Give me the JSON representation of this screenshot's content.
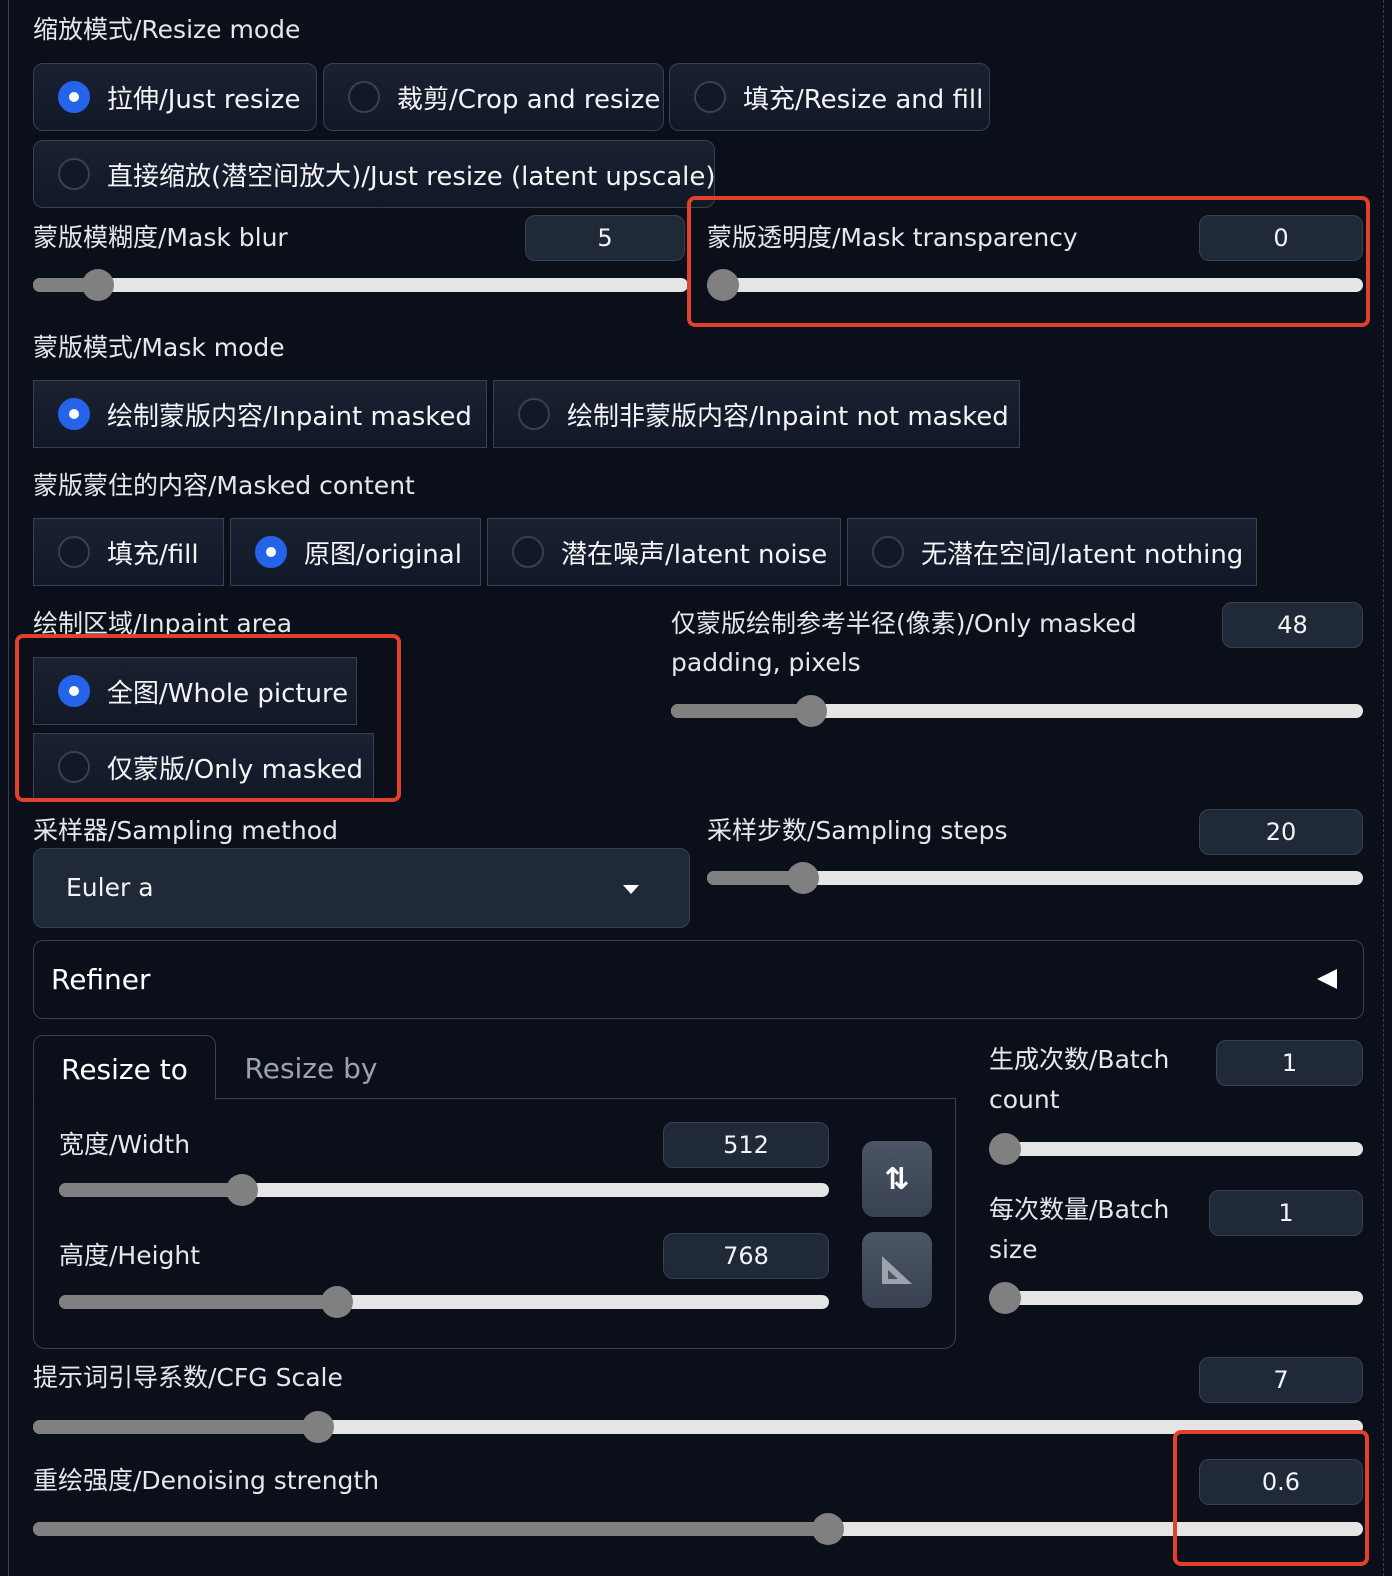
{
  "resize_mode": {
    "label": "缩放模式/Resize mode",
    "options": [
      "拉伸/Just resize",
      "裁剪/Crop and resize",
      "填充/Resize and fill",
      "直接缩放(潜空间放大)/Just resize (latent upscale)"
    ],
    "selected": 0
  },
  "mask_blur": {
    "label": "蒙版模糊度/Mask blur",
    "value": "5",
    "min": 0,
    "max": 64
  },
  "mask_transparency": {
    "label": "蒙版透明度/Mask transparency",
    "value": "0",
    "min": 0,
    "max": 100
  },
  "mask_mode": {
    "label": "蒙版模式/Mask mode",
    "options": [
      "绘制蒙版内容/Inpaint masked",
      "绘制非蒙版内容/Inpaint not masked"
    ],
    "selected": 0
  },
  "masked_content": {
    "label": "蒙版蒙住的内容/Masked content",
    "options": [
      "填充/fill",
      "原图/original",
      "潜在噪声/latent noise",
      "无潜在空间/latent nothing"
    ],
    "selected": 1
  },
  "inpaint_area": {
    "label": "绘制区域/Inpaint area",
    "options": [
      "全图/Whole picture",
      "仅蒙版/Only masked"
    ],
    "selected": 0
  },
  "padding": {
    "label": "仅蒙版绘制参考半径(像素)/Only masked padding, pixels",
    "value": "48",
    "min": 0,
    "max": 256
  },
  "sampler": {
    "label": "采样器/Sampling method",
    "value": "Euler a"
  },
  "steps": {
    "label": "采样步数/Sampling steps",
    "value": "20",
    "min": 1,
    "max": 150
  },
  "refiner": {
    "label": "Refiner"
  },
  "tabs": [
    "Resize to",
    "Resize by"
  ],
  "width": {
    "label": "宽度/Width",
    "value": "512",
    "min": 64,
    "max": 2048
  },
  "height": {
    "label": "高度/Height",
    "value": "768",
    "min": 64,
    "max": 2048
  },
  "batch_count": {
    "label": "生成次数/Batch count",
    "value": "1",
    "min": 1,
    "max": 100
  },
  "batch_size": {
    "label": "每次数量/Batch size",
    "value": "1",
    "min": 1,
    "max": 8
  },
  "cfg": {
    "label": "提示词引导系数/CFG Scale",
    "value": "7",
    "min": 1,
    "max": 30
  },
  "denoise": {
    "label": "重绘强度/Denoising strength",
    "value": "0.6",
    "min": 0,
    "max": 1
  },
  "colors": {
    "accent": "#2563eb",
    "highlight": "#e3402b",
    "background": "#0b0f19"
  }
}
